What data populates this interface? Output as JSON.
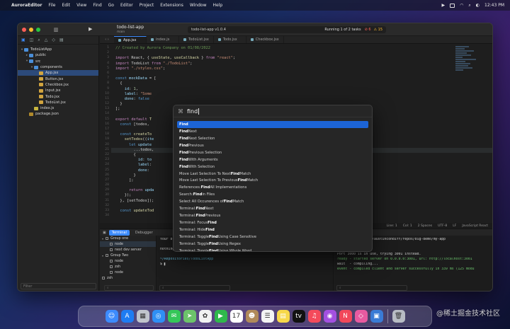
{
  "menubar": {
    "apple": "",
    "items": [
      "AuroraEditor",
      "File",
      "Edit",
      "View",
      "Find",
      "Go",
      "Editor",
      "Project",
      "Extensions",
      "Window",
      "Help"
    ],
    "clock": "12:43 PM"
  },
  "titlebar": {
    "project_name": "todo-list-app",
    "branch": "main",
    "scheme": "todo-list-app v1.0.4",
    "run_status": "Running 1 of 2 tasks",
    "errors": "⊘ 6",
    "warnings": "⚠ 15"
  },
  "sidebar": {
    "tree": [
      {
        "label": "TodoListApp",
        "type": "folder",
        "depth": 0,
        "open": true
      },
      {
        "label": "public",
        "type": "folder",
        "depth": 1,
        "open": false
      },
      {
        "label": "src",
        "type": "folder",
        "depth": 1,
        "open": true
      },
      {
        "label": "components",
        "type": "folder",
        "depth": 2,
        "open": true
      },
      {
        "label": "App.jsx",
        "type": "jsx",
        "depth": 3,
        "selected": true
      },
      {
        "label": "Button.jsx",
        "type": "jsx",
        "depth": 3
      },
      {
        "label": "Checkbox.jsx",
        "type": "jsx",
        "depth": 3
      },
      {
        "label": "Input.jsx",
        "type": "jsx",
        "depth": 3
      },
      {
        "label": "Todo.jsx",
        "type": "jsx",
        "depth": 3
      },
      {
        "label": "TodoList.jsx",
        "type": "jsx",
        "depth": 3
      },
      {
        "label": "index.js",
        "type": "js",
        "depth": 2
      },
      {
        "label": "package.json",
        "type": "json",
        "depth": 1
      }
    ],
    "filter_placeholder": "Filter"
  },
  "tabs": [
    {
      "label": "App.jsx",
      "active": true
    },
    {
      "label": "index.js"
    },
    {
      "label": "TodoList.jsx"
    },
    {
      "label": "Todo.jsx"
    },
    {
      "label": "Checkbox.jsx"
    }
  ],
  "editor": {
    "line_numbers": [
      "1",
      "2",
      "3",
      "4",
      "5",
      "6",
      "7",
      "8",
      "9",
      "10",
      "11",
      "12",
      "13",
      "14",
      "15",
      "16",
      "17",
      "18",
      "19",
      "20",
      "21",
      "22",
      "23",
      "24",
      "25",
      "26",
      "27",
      "28",
      "29",
      "30",
      "31",
      "32",
      "33",
      "34"
    ],
    "status": [
      "Line: 1",
      "Col: 1",
      "2 Spaces",
      "UTF-8",
      "LF",
      "JavaScript React"
    ]
  },
  "palette": {
    "query": "find",
    "items": [
      {
        "pre": "",
        "match": "Find",
        "post": ""
      },
      {
        "pre": "",
        "match": "Find",
        "post": " Next"
      },
      {
        "pre": "",
        "match": "Find",
        "post": " Next Selection"
      },
      {
        "pre": "",
        "match": "Find",
        "post": " Previous"
      },
      {
        "pre": "",
        "match": "Find",
        "post": " Previous Selection"
      },
      {
        "pre": "",
        "match": "Find",
        "post": " With Arguments"
      },
      {
        "pre": "",
        "match": "Find",
        "post": " With Selection"
      },
      {
        "pre": "Move Last Selection To Next ",
        "match": "Find",
        "post": " Match"
      },
      {
        "pre": "Move Last Selection To Previous ",
        "match": "Find",
        "post": " Match"
      },
      {
        "pre": "References: ",
        "match": "Find",
        "post": " All Implementations"
      },
      {
        "pre": "Search: ",
        "match": "Find",
        "post": " in Files"
      },
      {
        "pre": "Select All Occurences of ",
        "match": "Find",
        "post": " Match"
      },
      {
        "pre": "Terminal: ",
        "match": "Find",
        "post": " Next"
      },
      {
        "pre": "Terminal: ",
        "match": "Find",
        "post": " Previous"
      },
      {
        "pre": "Terminal: Focus ",
        "match": "Find",
        "post": ""
      },
      {
        "pre": "Terminal: Hide ",
        "match": "Find",
        "post": ""
      },
      {
        "pre": "Terminal: Toggle ",
        "match": "Find",
        "post": " Using Case Sensitive"
      },
      {
        "pre": "Terminal: Toggle ",
        "match": "Find",
        "post": " Using Regex"
      },
      {
        "pre": "Terminal: Toggle ",
        "match": "Find",
        "post": " Using Whole Word"
      }
    ]
  },
  "debug": {
    "tabs": [
      "Terminal",
      "Debugger"
    ],
    "processes": [
      {
        "label": "Group one",
        "type": "group"
      },
      {
        "label": "node",
        "type": "item",
        "selected": true
      },
      {
        "label": "next dev server",
        "type": "item"
      },
      {
        "label": "Group Two",
        "type": "group"
      },
      {
        "label": "node",
        "type": "item"
      },
      {
        "label": "zsh",
        "type": "item"
      },
      {
        "label": "node",
        "type": "item"
      },
      {
        "label": "zsh",
        "type": "item-root"
      }
    ]
  },
  "terminal1": {
    "lines": [
      "Your branch is up to date with 'origin/master'.",
      "",
      "nothing to commit, working tree clean",
      "",
      "~/Repositories/TodoListApp",
      "$ ▌"
    ]
  },
  "terminal2": {
    "lines": [
      "v0.1.0 dev /Users/austincondiff/repos/big-demo/my-app",
      "dev",
      "",
      "Port 3000 is in use, trying 3001 instead.",
      "ready - started server on 0.0.0.0:3001, url: http://localhost:3001",
      "wait  - compiling...",
      "event - compiled client and server successfully in 339 ms (125 modu"
    ]
  },
  "dock": {
    "apps": [
      {
        "name": "finder",
        "bg": "#3d8bfd",
        "glyph": "☺"
      },
      {
        "name": "app-store",
        "bg": "#1e7cf2",
        "glyph": "A"
      },
      {
        "name": "launchpad",
        "bg": "#c0c4cc",
        "glyph": "▦"
      },
      {
        "name": "safari",
        "bg": "#2f8ff5",
        "glyph": "◎"
      },
      {
        "name": "messages",
        "bg": "#35c759",
        "glyph": "✉"
      },
      {
        "name": "maps",
        "bg": "#6cc36a",
        "glyph": "➤"
      },
      {
        "name": "photos",
        "bg": "#f2f2f2",
        "glyph": "✿"
      },
      {
        "name": "facetime",
        "bg": "#2fb84c",
        "glyph": "▶"
      },
      {
        "name": "calendar",
        "bg": "#ffffff",
        "glyph": "17"
      },
      {
        "name": "contacts",
        "bg": "#b08a5a",
        "glyph": "☻"
      },
      {
        "name": "reminders",
        "bg": "#f4f4f4",
        "glyph": "☰"
      },
      {
        "name": "notes",
        "bg": "#f7d84a",
        "glyph": "▤"
      },
      {
        "name": "tv",
        "bg": "#111111",
        "glyph": "tv"
      },
      {
        "name": "music",
        "bg": "#f44a5b",
        "glyph": "♫"
      },
      {
        "name": "podcasts",
        "bg": "#a350e0",
        "glyph": "◉"
      },
      {
        "name": "news",
        "bg": "#f2485a",
        "glyph": "N"
      },
      {
        "name": "aurora-editor",
        "bg": "#e85aa0",
        "glyph": "◇"
      },
      {
        "name": "preview",
        "bg": "#3a7bd5",
        "glyph": "▣"
      },
      {
        "name": "trash",
        "bg": "#b8bcc4",
        "glyph": "🗑"
      }
    ]
  },
  "watermark": "@稀土掘金技术社区"
}
